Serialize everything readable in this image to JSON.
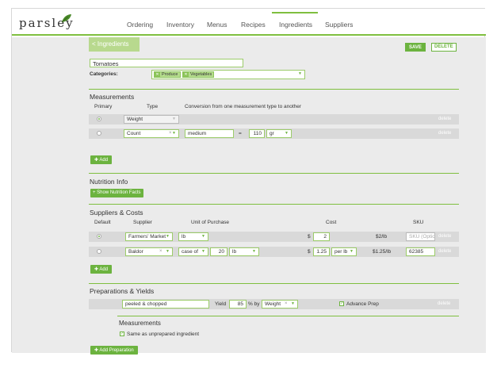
{
  "nav": {
    "logo": "parsley",
    "items": [
      "Ordering",
      "Inventory",
      "Menus",
      "Recipes",
      "Ingredients",
      "Suppliers"
    ],
    "active": "Ingredients"
  },
  "header": {
    "crumb": "< Ingredients",
    "save": "SAVE",
    "delete": "DELETE"
  },
  "ingredient": {
    "name": "Tomatoes",
    "categories_label": "Categories:",
    "categories": [
      "Produce",
      "Vegetables"
    ]
  },
  "measurements": {
    "title": "Measurements",
    "col_primary": "Primary",
    "col_type": "Type",
    "col_conversion": "Conversion from one measurement type to another",
    "rows": [
      {
        "type": "Weight",
        "name": "",
        "qty": "",
        "unit": "",
        "delete": "delete"
      },
      {
        "type": "Count",
        "name": "medium",
        "eq": "=",
        "qty": "110",
        "unit": "gr",
        "delete": "delete"
      }
    ],
    "add": "Add"
  },
  "nutrition": {
    "title": "Nutrition Info",
    "button": "+ Show Nutrition Facts"
  },
  "suppliers": {
    "title": "Suppliers & Costs",
    "col_default": "Default",
    "col_supplier": "Supplier",
    "col_unit": "Unit of Purchase",
    "col_cost": "Cost",
    "col_sku": "SKU",
    "rows": [
      {
        "supplier": "Farmers' Market",
        "unit": "lb",
        "currency": "$",
        "cost": "2",
        "per_unit": "$2/lb",
        "sku_placeholder": "SKU (Optional)",
        "delete": "delete"
      },
      {
        "supplier": "Baldor",
        "unit": "case of",
        "qty": "20",
        "qty_unit": "lb",
        "currency": "$",
        "cost": "1.25",
        "cost_per": "per lb",
        "per_unit": "$1.25/lb",
        "sku": "62385",
        "delete": "delete"
      }
    ],
    "add": "Add"
  },
  "preparations": {
    "title": "Preparations & Yields",
    "rows": [
      {
        "name": "peeled & chopped",
        "yield_label": "Yield",
        "yield": "85",
        "by_label": "% by",
        "by": "Weight",
        "advance": "Advance Prep",
        "delete": "delete"
      }
    ],
    "measurements_title": "Measurements",
    "same_as": "Same as unprepared ingredient",
    "add": "Add Preparation"
  }
}
